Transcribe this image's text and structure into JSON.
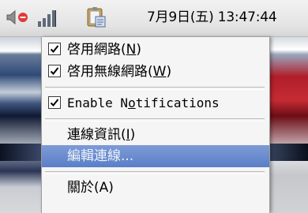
{
  "tray": {
    "clock_text": "7月9日(五) 13:47:44",
    "icons": [
      "speaker-muted-icon",
      "network-signal-icon",
      "clipboard-icon"
    ]
  },
  "menu": {
    "items": [
      {
        "pre": "啓用網路(",
        "accel": "N",
        "post": ")",
        "checked": true
      },
      {
        "pre": "啓用無線網路(",
        "accel": "W",
        "post": ")",
        "checked": true
      },
      {
        "pre": "Enable N",
        "accel": "o",
        "post": "tifications",
        "checked": true
      },
      {
        "pre": "連線資訊(",
        "accel": "I",
        "post": ")",
        "checked": false
      },
      {
        "label": "編輯連線...",
        "selected": true
      },
      {
        "label": "關於(A)"
      }
    ]
  },
  "colors": {
    "highlight": "#5a7fc7",
    "menu_background": "#f5f5f5"
  }
}
